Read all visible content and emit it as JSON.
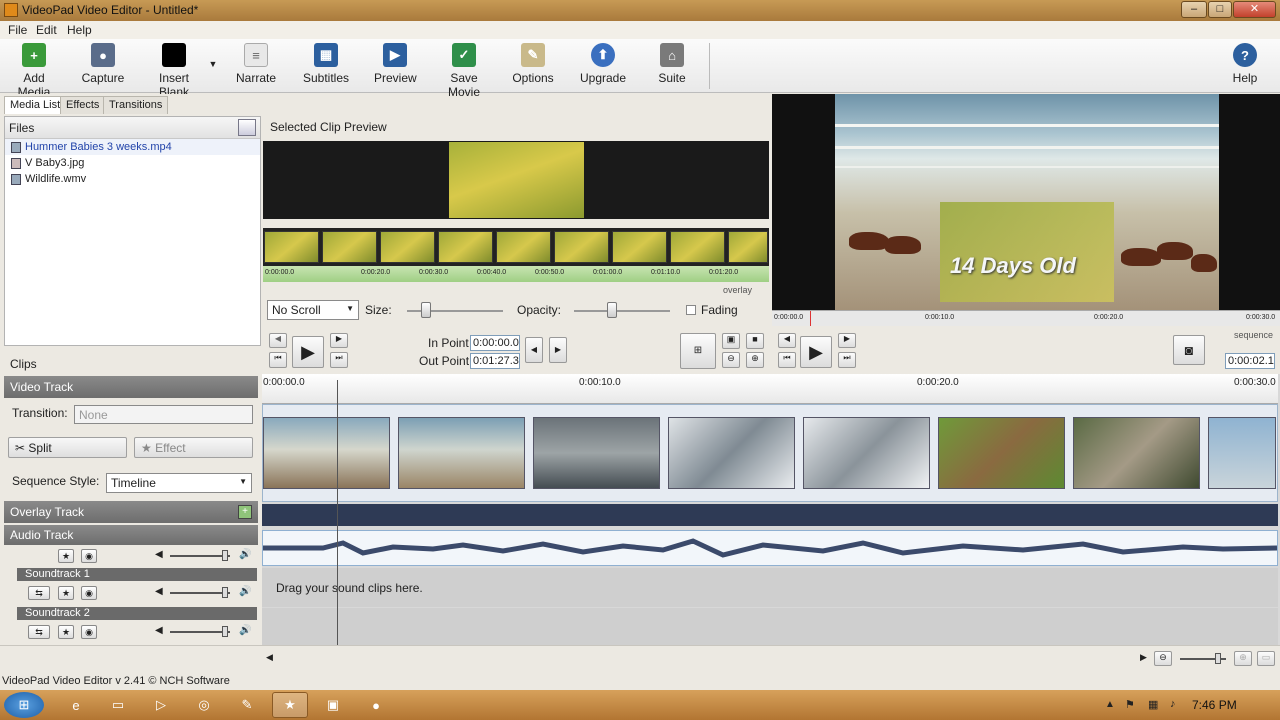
{
  "window": {
    "title": "VideoPad Video Editor - Untitled*"
  },
  "menu": [
    "File",
    "Edit",
    "Help"
  ],
  "toolbar": [
    {
      "label": "Add Media",
      "icon": "add-media-icon"
    },
    {
      "label": "Capture",
      "icon": "capture-icon"
    },
    {
      "label": "Insert Blank",
      "icon": "insert-blank-icon"
    },
    {
      "label": "Narrate",
      "icon": "narrate-icon"
    },
    {
      "label": "Subtitles",
      "icon": "subtitles-icon"
    },
    {
      "label": "Preview",
      "icon": "preview-icon"
    },
    {
      "label": "Save Movie",
      "icon": "save-movie-icon"
    },
    {
      "label": "Options",
      "icon": "options-icon"
    },
    {
      "label": "Upgrade",
      "icon": "upgrade-icon"
    },
    {
      "label": "Suite",
      "icon": "suite-icon"
    },
    {
      "label": "Help",
      "icon": "help-icon"
    }
  ],
  "tabs": [
    "Media List",
    "Effects",
    "Transitions"
  ],
  "files": {
    "header": "Files",
    "items": [
      "Hummer Babies 3 weeks.mp4",
      "V Baby3.jpg",
      "Wildlife.wmv"
    ]
  },
  "selected_preview": {
    "header": "Selected Clip Preview",
    "ruler": [
      "0:00:00.0",
      "0:00:20.0",
      "0:00:30.0",
      "0:00:40.0",
      "0:00:50.0",
      "0:01:00.0",
      "0:01:10.0",
      "0:01:20.0"
    ],
    "tag": "overlay",
    "scroll_mode": "No Scroll",
    "size_label": "Size:",
    "opacity_label": "Opacity:",
    "fading_label": "Fading",
    "in_point_label": "In Point",
    "in_point_value": "0:00:00.0",
    "out_point_label": "Out Point",
    "out_point_value": "0:01:27.3",
    "size_level": 0.2,
    "opacity_level": 0.4
  },
  "main_preview": {
    "overlay_text": "14 Days Old",
    "ruler": [
      "0:00:00.0",
      "0:00:10.0",
      "0:00:20.0",
      "0:00:30.0"
    ],
    "tag": "sequence",
    "time": "0:00:02.1"
  },
  "clips_panel": {
    "header": "Clips",
    "video_track": "Video Track",
    "transition_label": "Transition:",
    "transition_value": "None",
    "split_label": "Split",
    "effect_label": "Effect",
    "sequence_style_label": "Sequence Style:",
    "sequence_style_value": "Timeline",
    "overlay_track": "Overlay Track",
    "audio_track": "Audio Track",
    "soundtrack1": "Soundtrack 1",
    "soundtrack2": "Soundtrack 2"
  },
  "timeline": {
    "ruler": [
      "0:00:00.0",
      "0:00:10.0",
      "0:00:20.0",
      "0:00:30.0"
    ],
    "drop_hint": "Drag your sound clips here."
  },
  "status": {
    "text": "VideoPad Video Editor v 2.41 © NCH Software"
  },
  "taskbar": {
    "clock": "7:46 PM"
  }
}
